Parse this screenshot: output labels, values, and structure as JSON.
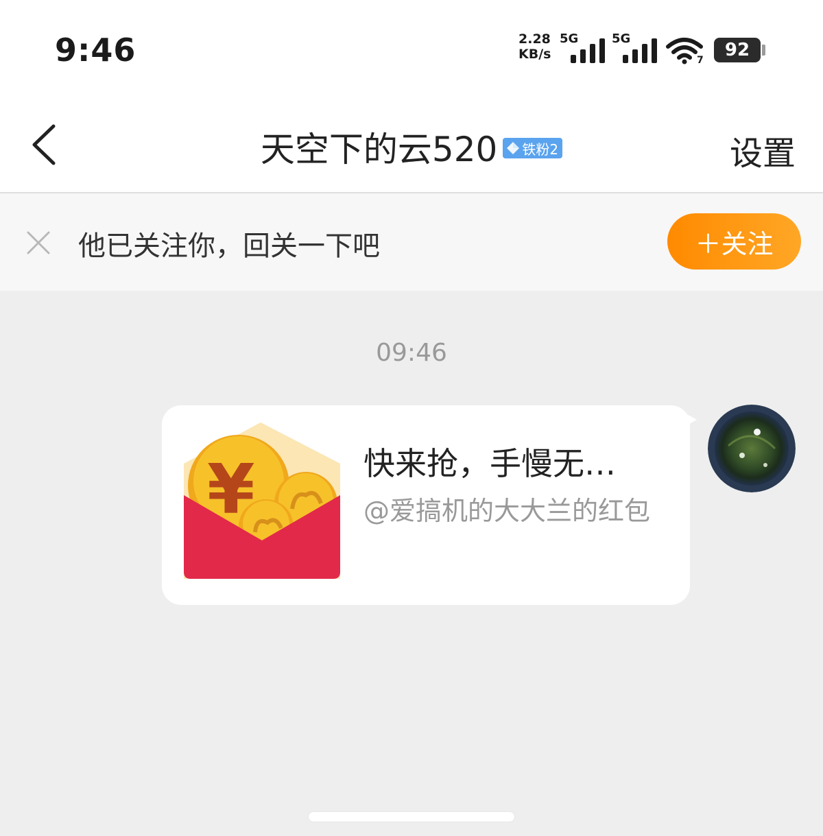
{
  "status_bar": {
    "time": "9:46",
    "net_rate_value": "2.28",
    "net_rate_unit": "KB/s",
    "sim1_network": "5G",
    "sim2_network": "5G",
    "wifi_icon": "wifi-icon",
    "battery": "92"
  },
  "header": {
    "back_icon": "chevron-left-icon",
    "title": "天空下的云520",
    "fan_badge": "铁粉2",
    "settings_label": "设置"
  },
  "follow_banner": {
    "close_icon": "close-icon",
    "text": "他已关注你，回关一下吧",
    "follow_button": "＋关注"
  },
  "chat": {
    "timestamp": "09:46",
    "message": {
      "type": "red-packet",
      "icon": "red-envelope-icon",
      "title": "快来抢，手慢无…",
      "subtitle": "@爱搞机的大大兰的红包"
    },
    "avatar": "avatar"
  },
  "colors": {
    "accent_orange": "#ff8a00",
    "badge_blue": "#5aa3ee",
    "envelope_red": "#e2294a",
    "coin_yellow": "#f7c12a"
  }
}
